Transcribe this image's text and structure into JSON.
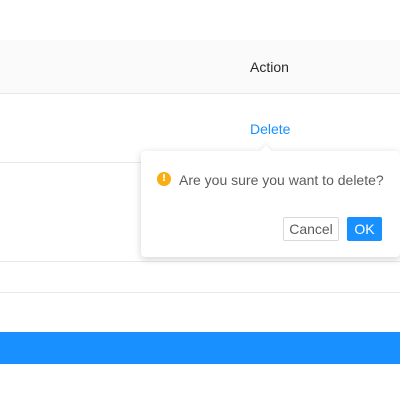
{
  "table": {
    "header": {
      "action_label": "Action"
    },
    "rows": [
      {
        "action_link": "Delete"
      }
    ]
  },
  "popconfirm": {
    "icon": "exclamation-circle-icon",
    "icon_glyph": "!",
    "message": "Are you sure you want to delete?",
    "cancel_label": "Cancel",
    "ok_label": "OK"
  },
  "colors": {
    "primary": "#1890ff",
    "warning": "#faad14",
    "header_bg": "#fafafa",
    "border": "#e8e8e8"
  }
}
